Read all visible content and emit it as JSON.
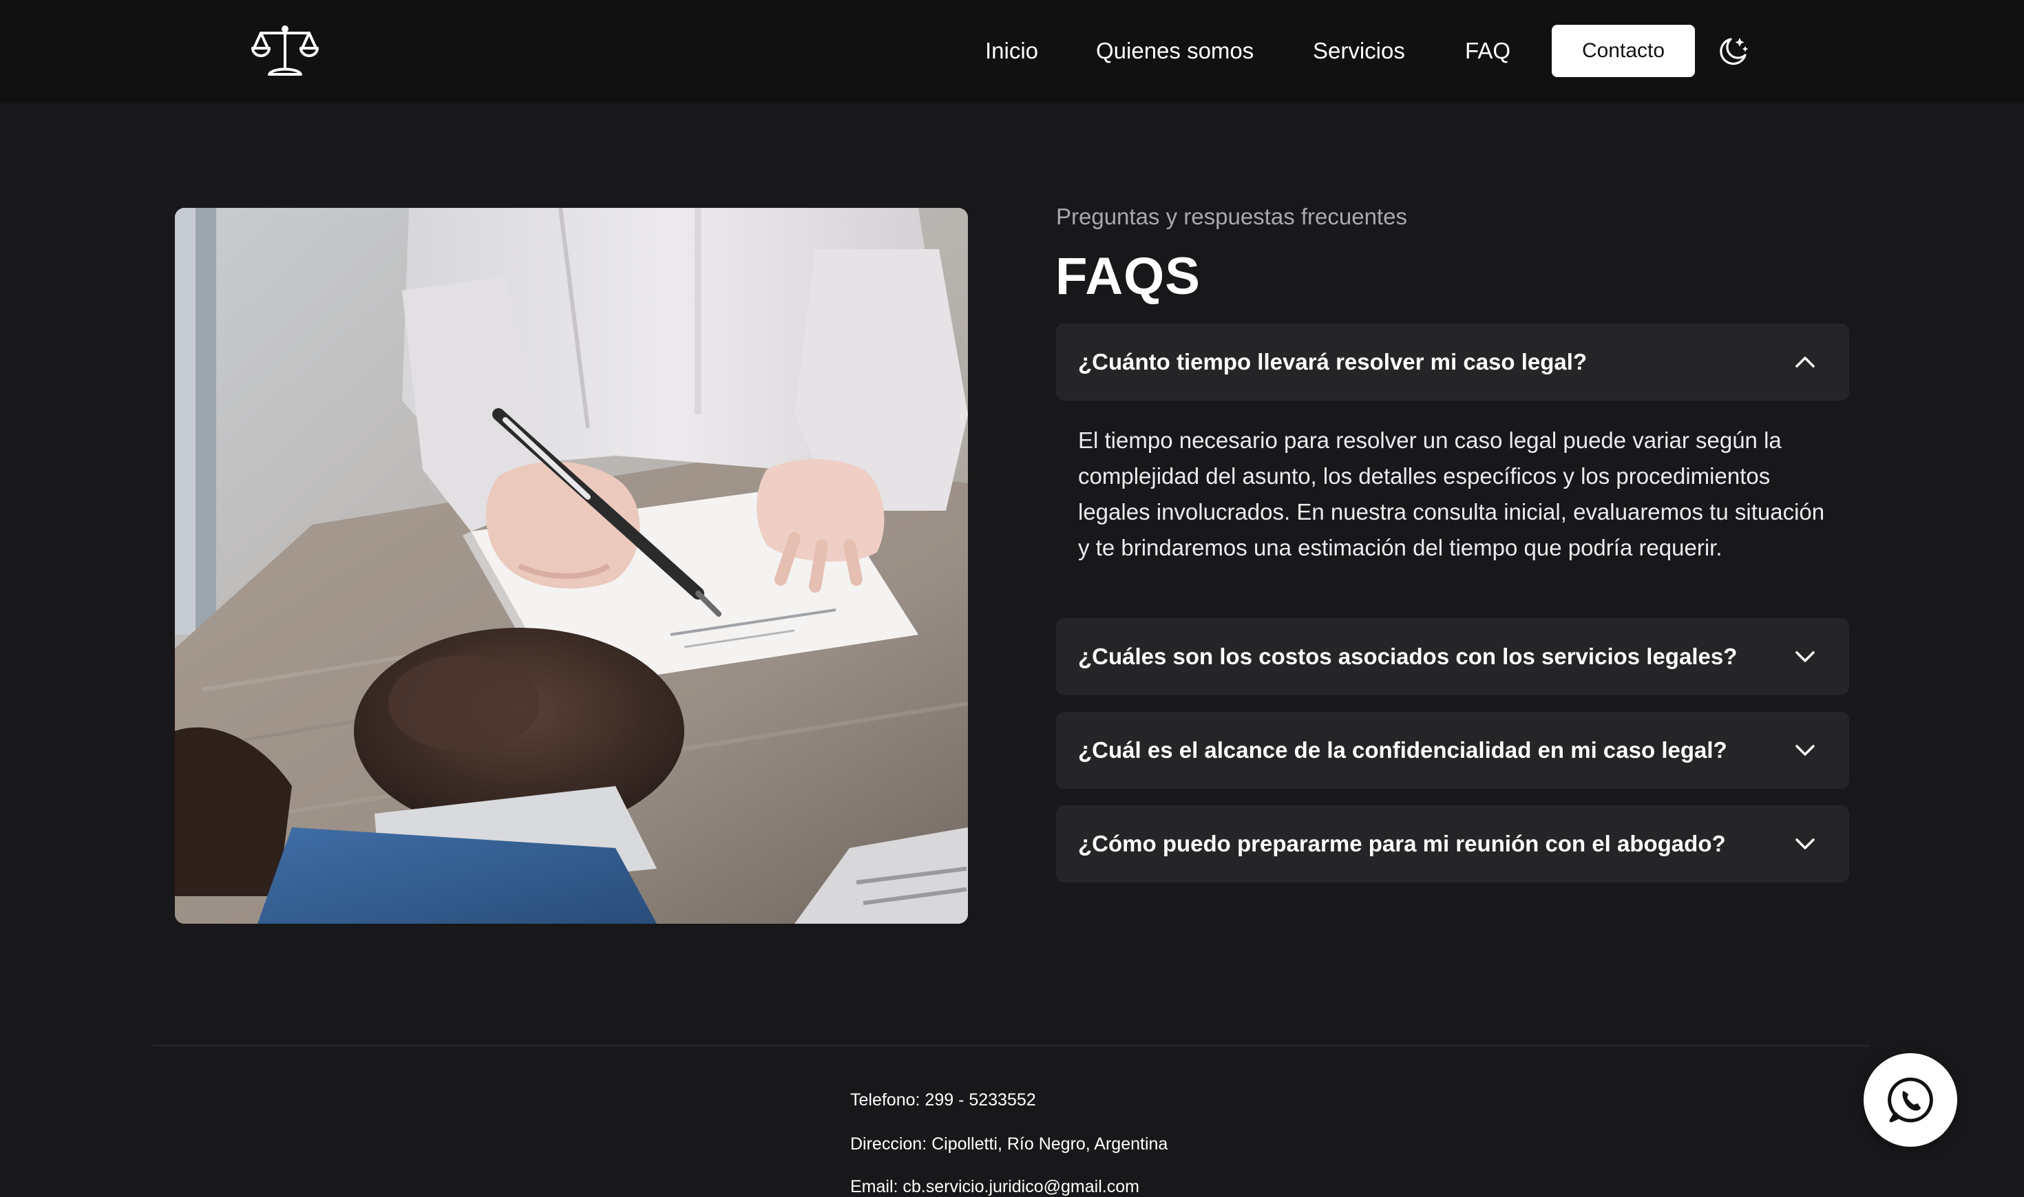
{
  "nav": {
    "items": [
      {
        "label": "Inicio"
      },
      {
        "label": "Quienes somos"
      },
      {
        "label": "Servicios"
      },
      {
        "label": "FAQ"
      }
    ],
    "contact_label": "Contacto",
    "logo_icon": "scales-of-justice-icon",
    "theme_icon": "moon-stars-icon"
  },
  "faq": {
    "subtitle": "Preguntas y respuestas frecuentes",
    "title": "FAQS",
    "items": [
      {
        "question": "¿Cuánto tiempo llevará resolver mi caso legal?",
        "expanded": true,
        "answer": "El tiempo necesario para resolver un caso legal puede variar según la complejidad del asunto, los detalles específicos y los procedimientos legales involucrados. En nuestra consulta inicial, evaluaremos tu situación y te brindaremos una estimación del tiempo que podría requerir."
      },
      {
        "question": "¿Cuáles son los costos asociados con los servicios legales?",
        "expanded": false
      },
      {
        "question": "¿Cuál es el alcance de la confidencialidad en mi caso legal?",
        "expanded": false
      },
      {
        "question": "¿Cómo puedo prepararme para mi reunión con el abogado?",
        "expanded": false
      }
    ]
  },
  "footer": {
    "phone": "Telefono: 299 - 5233552",
    "address": "Direccion: Cipolletti, Río Negro, Argentina",
    "email": "Email: cb.servicio.juridico@gmail.com"
  },
  "whatsapp_icon": "whatsapp-icon",
  "colors": {
    "header_bg": "#111112",
    "page_bg": "#18181a",
    "faq_item_bg": "#252527",
    "subtitle": "#a9a9ad",
    "button_bg": "#ffffff"
  }
}
